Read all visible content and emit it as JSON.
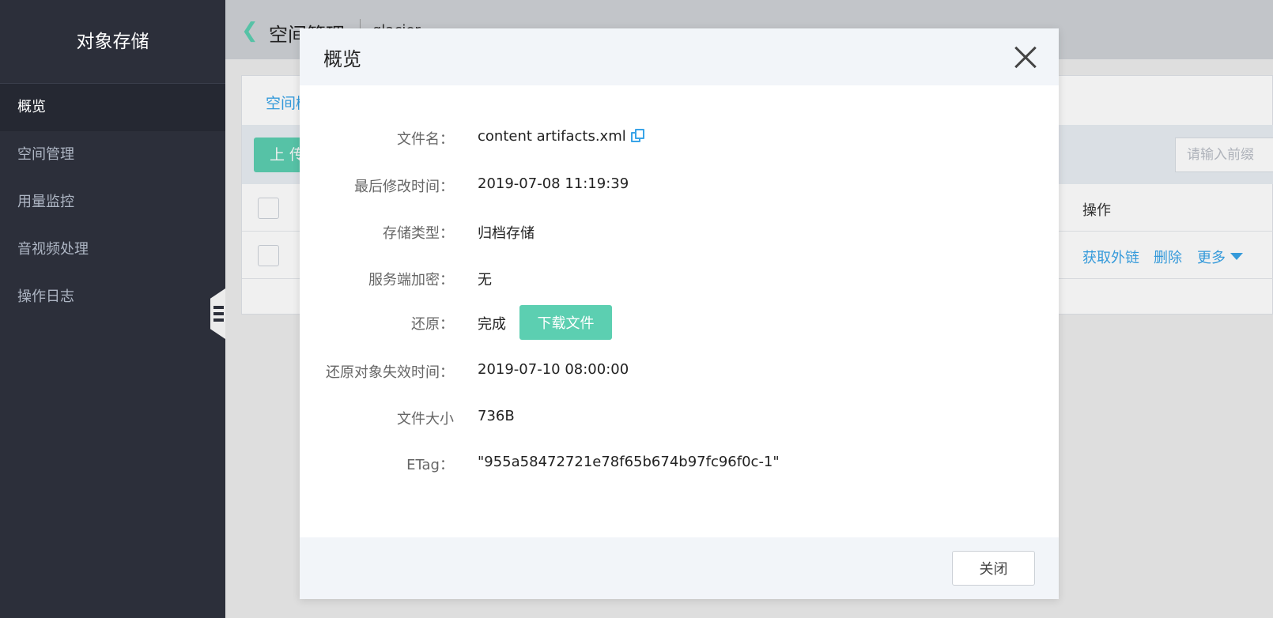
{
  "sidebar": {
    "title": "对象存储",
    "items": [
      {
        "label": "概览",
        "active": true
      },
      {
        "label": "空间管理",
        "active": false
      },
      {
        "label": "用量监控",
        "active": false
      },
      {
        "label": "音视频处理",
        "active": false
      },
      {
        "label": "操作日志",
        "active": false
      }
    ]
  },
  "topbar": {
    "back_icon": "chevron-left-icon",
    "title": "空间管理",
    "bucket": "glacier"
  },
  "panel": {
    "tab_label": "空间概览",
    "upload_label": "上 传",
    "search_placeholder": "请输入前缀",
    "table_header_op": "操作",
    "row_actions": {
      "get_link": "获取外链",
      "delete": "删除",
      "more": "更多"
    }
  },
  "modal": {
    "title": "概览",
    "fields": {
      "filename_label": "文件名：",
      "filename_value": "content artifacts.xml",
      "modified_label": "最后修改时间：",
      "modified_value": "2019-07-08 11:19:39",
      "storage_label": "存储类型：",
      "storage_value": "归档存储",
      "encryption_label": "服务端加密：",
      "encryption_value": "无",
      "restore_label": "还原：",
      "restore_value": "完成",
      "download_label": "下载文件",
      "expire_label": "还原对象失效时间：",
      "expire_value": "2019-07-10 08:00:00",
      "size_label": "文件大小",
      "size_value": "736B",
      "etag_label": "ETag：",
      "etag_value": "\"955a58472721e78f65b674b97fc96f0c-1\""
    },
    "close_label": "关闭"
  },
  "colors": {
    "sidebar_bg": "#2c2f3a",
    "accent_green": "#5ccfb1",
    "link_blue": "#39a4e8"
  }
}
